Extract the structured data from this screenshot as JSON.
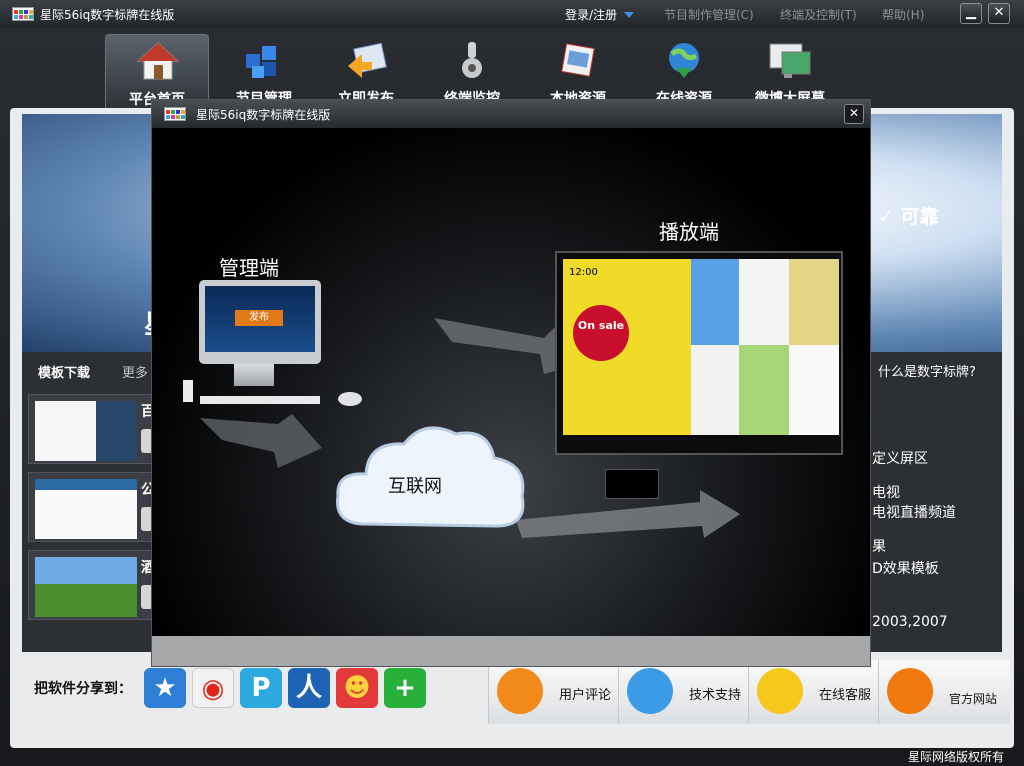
{
  "window": {
    "title": "星际56iq数字标牌在线版",
    "login": "登录/注册",
    "links": [
      "节目制作管理(C)",
      "终端及控制(T)",
      "帮助(H)"
    ],
    "minimize": "▁",
    "close": "✕"
  },
  "nav": {
    "items": [
      {
        "label": "平台首页",
        "icon": "house-icon",
        "active": true
      },
      {
        "label": "节目管理",
        "icon": "cubes-icon"
      },
      {
        "label": "立即发布",
        "icon": "publish-icon"
      },
      {
        "label": "终端监控",
        "icon": "camera-icon"
      },
      {
        "label": "本地资源",
        "icon": "folder-icon"
      },
      {
        "label": "在线资源",
        "icon": "globe-icon"
      },
      {
        "label": "微博大屏幕",
        "icon": "screen-icon"
      }
    ]
  },
  "main": {
    "banner_left": "星",
    "banner_right": "✓ 可靠",
    "templates_title": "模板下载",
    "templates_more": "更多",
    "what_link": "什么是数字标牌?",
    "template_chips": [
      "百",
      "公",
      "酒"
    ],
    "features": [
      "定义屏区",
      "电视",
      "电视直播频道",
      "果",
      "D效果模板",
      "2003,2007"
    ]
  },
  "share": {
    "label": "把软件分享到：",
    "icons": [
      "qzone-icon",
      "weibo-icon",
      "pengyou-icon",
      "renren-icon",
      "kaixin-icon",
      "plus-icon"
    ]
  },
  "support": {
    "items": [
      "用户评论",
      "技术支持",
      "在线客服",
      "官方网站"
    ]
  },
  "footer": {
    "copyright": "星际网络版权所有"
  },
  "modal": {
    "title": "星际56iq数字标牌在线版",
    "close": "✕",
    "label_manage": "管理端",
    "label_player": "播放端",
    "label_net": "互联网",
    "monitor_button": "发布",
    "tv_clock": "12:00",
    "tv_sale": "On sale"
  },
  "colors": {
    "accent": "#3c8ddf",
    "dark_bg": "#2c2f34",
    "modal_bg": "#050505",
    "tv_yellow": "#f0dc28"
  }
}
